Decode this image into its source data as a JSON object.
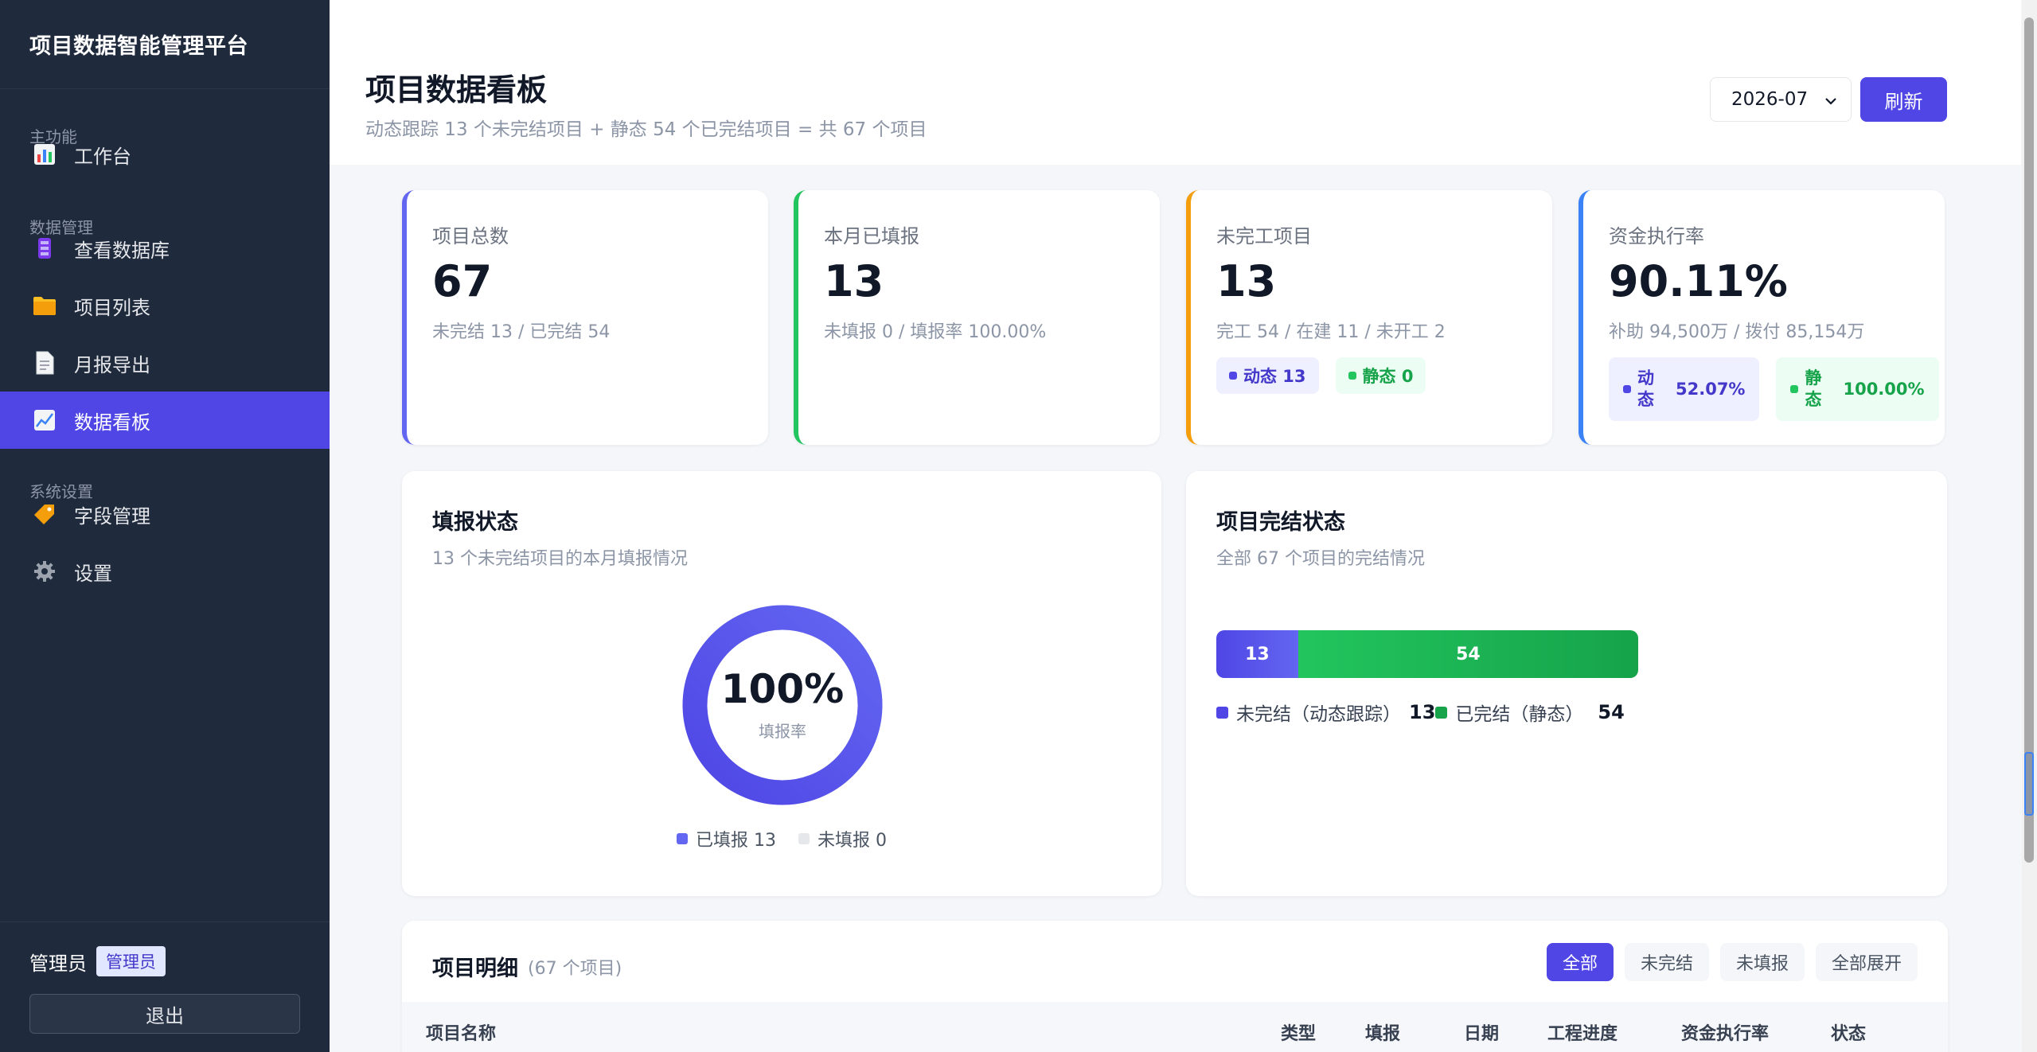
{
  "app": {
    "title": "项目数据智能管理平台"
  },
  "sidebar": {
    "sections": [
      {
        "label": "主功能"
      },
      {
        "label": "数据管理"
      },
      {
        "label": "系统设置"
      }
    ],
    "items": [
      {
        "label": "工作台",
        "icon": "bar-chart-icon"
      },
      {
        "label": "查看数据库",
        "icon": "database-icon"
      },
      {
        "label": "项目列表",
        "icon": "folder-icon"
      },
      {
        "label": "月报导出",
        "icon": "document-icon"
      },
      {
        "label": "数据看板",
        "icon": "trend-chart-icon",
        "active": true
      },
      {
        "label": "字段管理",
        "icon": "tag-icon"
      },
      {
        "label": "设置",
        "icon": "gear-icon"
      }
    ],
    "user": {
      "name": "管理员",
      "role": "管理员"
    },
    "logout": "退出"
  },
  "header": {
    "title": "项目数据看板",
    "subtitle": "动态跟踪 13 个未完结项目 + 静态 54 个已完结项目 = 共 67 个项目",
    "month": "2026-07",
    "refresh": "刷新"
  },
  "stats": [
    {
      "label": "项目总数",
      "value": "67",
      "desc": "未完结 13 / 已完结 54",
      "color": "#6366f1"
    },
    {
      "label": "本月已填报",
      "value": "13",
      "desc": "未填报 0 / 填报率 100.00%",
      "color": "#22c55e"
    },
    {
      "label": "未完工项目",
      "value": "13",
      "desc": "完工 54 / 在建 11 / 未开工 2",
      "color": "#f59e0b",
      "pills": [
        {
          "text": "动态 13"
        },
        {
          "text": "静态 0"
        }
      ]
    },
    {
      "label": "资金执行率",
      "value": "90.11%",
      "desc": "补助 94,500万 / 拨付 85,154万",
      "color": "#3b82f6",
      "pills": [
        {
          "label": "动态",
          "value": "52.07%"
        },
        {
          "label": "静态",
          "value": "100.00%"
        }
      ]
    }
  ],
  "fill_status": {
    "title": "填报状态",
    "subtitle": "13 个未完结项目的本月填报情况",
    "percent_text": "100%",
    "center_label": "填报率",
    "filled_fraction": 1.0,
    "legend": [
      {
        "text": "已填报 13",
        "color": "#6366f1"
      },
      {
        "text": "未填报 0",
        "color": "#e5e7eb"
      }
    ]
  },
  "completion": {
    "title": "项目完结状态",
    "subtitle": "全部 67 个项目的完结情况",
    "segments": [
      {
        "value": 13,
        "label": "13",
        "color": "#6366f1"
      },
      {
        "value": 54,
        "label": "54",
        "color": "#22c55e"
      }
    ],
    "legend": [
      {
        "text": "未完结（动态跟踪）",
        "num": "13",
        "color": "#4f46e5"
      },
      {
        "text": "已完结（静态）",
        "num": "54",
        "color": "#16a34a"
      }
    ]
  },
  "detail": {
    "title": "项目明细",
    "count": "(67 个项目)",
    "filters": [
      {
        "label": "全部",
        "active": true
      },
      {
        "label": "未完结"
      },
      {
        "label": "未填报"
      },
      {
        "label": "全部展开"
      }
    ],
    "columns": [
      "项目名称",
      "类型",
      "填报",
      "日期",
      "工程进度",
      "资金执行率",
      "状态"
    ]
  },
  "colors": {
    "accent": "#4f46e5",
    "sidebar_bg": "#1f2a3c"
  }
}
